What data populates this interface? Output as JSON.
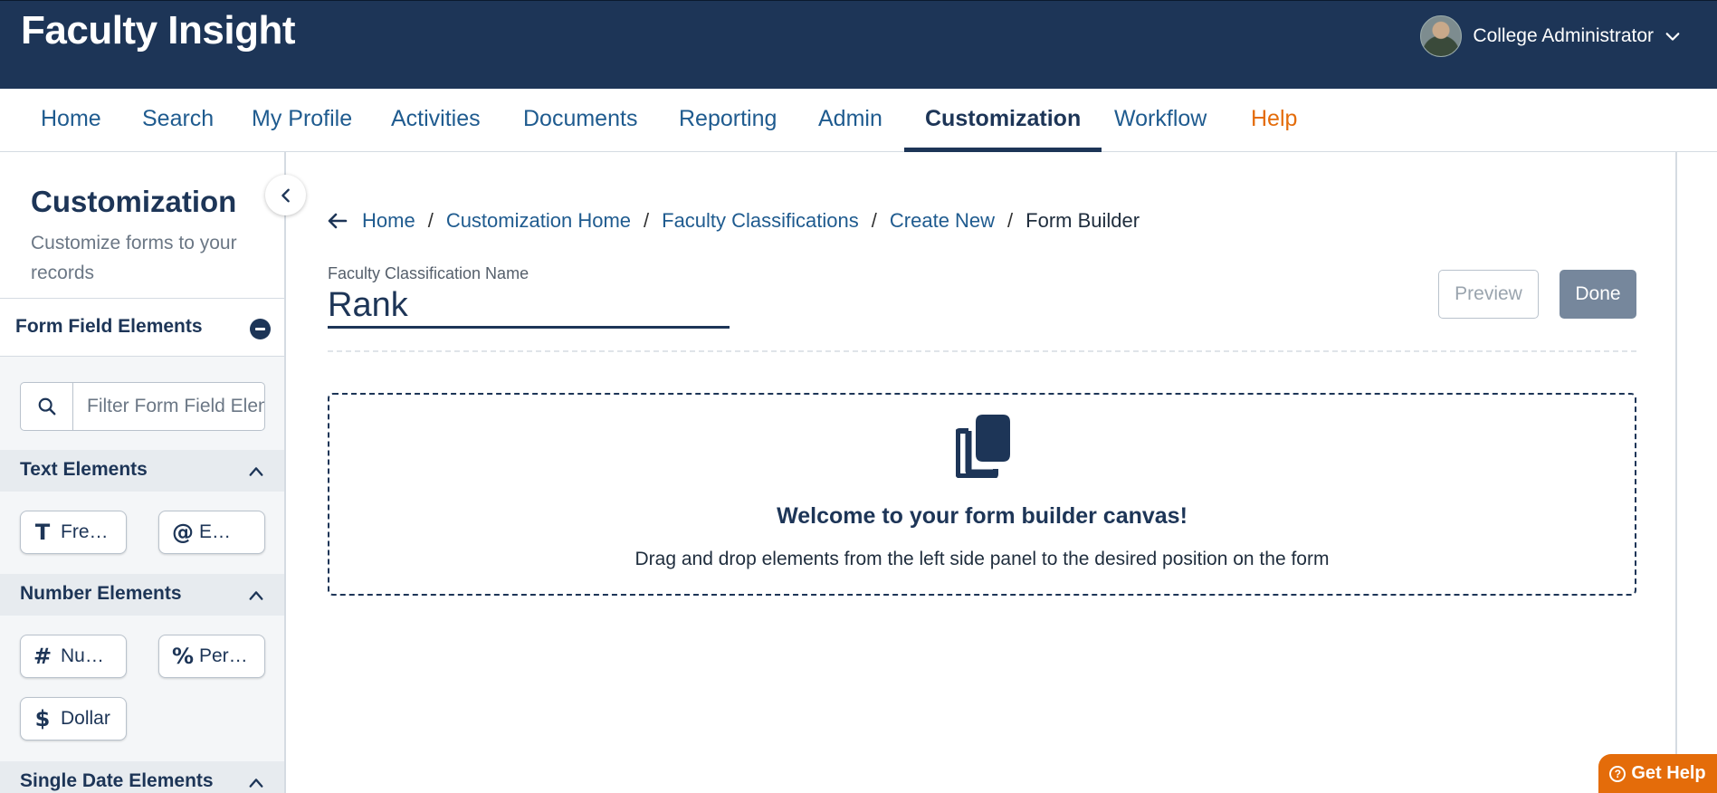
{
  "header": {
    "app_title": "Faculty Insight",
    "user_name": "College Administrator"
  },
  "nav": {
    "items": [
      {
        "label": "Home"
      },
      {
        "label": "Search"
      },
      {
        "label": "My Profile"
      },
      {
        "label": "Activities"
      },
      {
        "label": "Documents"
      },
      {
        "label": "Reporting"
      },
      {
        "label": "Admin"
      },
      {
        "label": "Customization"
      },
      {
        "label": "Workflow"
      },
      {
        "label": "Help"
      }
    ],
    "active": "Customization"
  },
  "sidebar": {
    "title": "Customization",
    "subtitle": "Customize forms to your records",
    "section_title": "Form Field Elements",
    "filter_placeholder": "Filter Form Field Elements",
    "groups": {
      "text": {
        "title": "Text Elements",
        "items": [
          {
            "glyph": "T",
            "icon": "text-icon",
            "label": "Fre…"
          },
          {
            "glyph": "@",
            "icon": "at-icon",
            "label": "E…"
          }
        ]
      },
      "number": {
        "title": "Number Elements",
        "items": [
          {
            "glyph": "#",
            "icon": "hash-icon",
            "label": "Nu…"
          },
          {
            "glyph": "%",
            "icon": "percent-icon",
            "label": "Per…"
          },
          {
            "glyph": "$",
            "icon": "dollar-icon",
            "label": "Dollar"
          }
        ]
      },
      "date": {
        "title": "Single Date Elements"
      }
    }
  },
  "main": {
    "breadcrumb": [
      "Home",
      "Customization Home",
      "Faculty Classifications",
      "Create New",
      "Form Builder"
    ],
    "field_label": "Faculty Classification Name",
    "field_value": "Rank",
    "preview_label": "Preview",
    "done_label": "Done",
    "canvas_title": "Welcome to your form builder canvas!",
    "canvas_subtitle": "Drag and drop elements from the left side panel to the desired position on the form"
  },
  "help_button": "Get Help",
  "colors": {
    "header_bg": "#1d3557",
    "link": "#1f5b8f",
    "help_accent": "#e46c0a",
    "done_bg": "#76879c"
  }
}
